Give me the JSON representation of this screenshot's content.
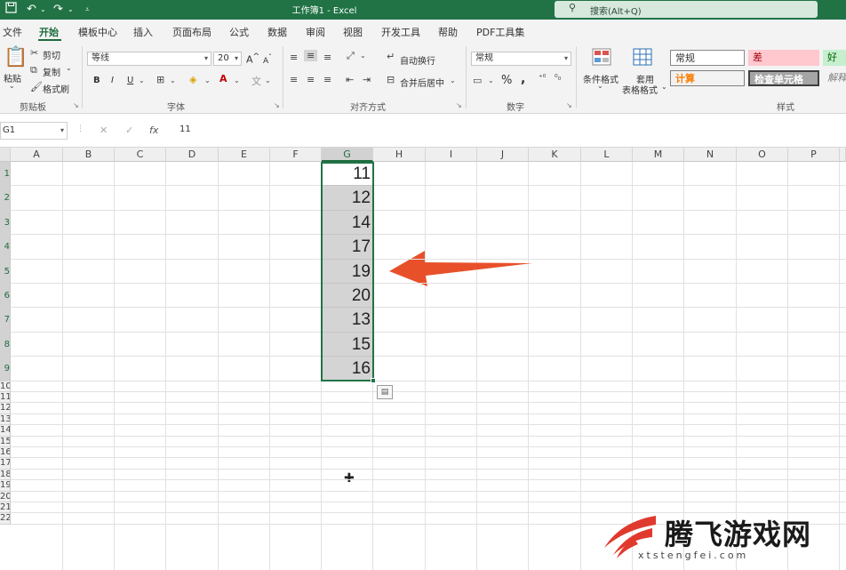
{
  "titlebar": {
    "title": "工作簿1  -  Excel",
    "search_placeholder": "搜索(Alt+Q)",
    "icons": [
      "save-icon",
      "undo-icon",
      "redo-icon",
      "customize-qat-icon",
      "search-icon"
    ]
  },
  "menu": {
    "tabs": [
      "文件",
      "开始",
      "模板中心",
      "插入",
      "页面布局",
      "公式",
      "数据",
      "审阅",
      "视图",
      "开发工具",
      "帮助",
      "PDF工具集"
    ],
    "active_tab": "开始"
  },
  "ribbon": {
    "clipboard": {
      "paste": "粘贴",
      "cut": "剪切",
      "copy": "复制",
      "format_painter": "格式刷",
      "label": "剪贴板"
    },
    "font": {
      "name": "等线",
      "size": "20",
      "bold": "B",
      "italic": "I",
      "underline": "U",
      "increase": "A",
      "decrease": "A",
      "label": "字体"
    },
    "alignment": {
      "wrap_text": "自动换行",
      "merge_center": "合并后居中",
      "label": "对齐方式"
    },
    "number": {
      "format": "常规",
      "percent": "%",
      "comma": ",",
      "label": "数字"
    },
    "styles": {
      "conditional_formatting": "条件格式",
      "format_as_table_1": "套用",
      "format_as_table_2": "表格格式",
      "normal": "常规",
      "bad": "差",
      "good": "好",
      "calculation": "计算",
      "check_cell": "检查单元格",
      "explanatory": "解释",
      "label": "样式"
    }
  },
  "formula_bar": {
    "name_box": "G1",
    "cancel": "✕",
    "enter": "✓",
    "fx": "fx",
    "value": "11"
  },
  "grid": {
    "columns": [
      "A",
      "B",
      "C",
      "D",
      "E",
      "F",
      "G",
      "H",
      "I",
      "J",
      "K",
      "L",
      "M",
      "N",
      "O",
      "P"
    ],
    "selected_column": "G",
    "rows": [
      "1",
      "2",
      "3",
      "4",
      "5",
      "6",
      "7",
      "8",
      "9",
      "10",
      "11",
      "12",
      "13",
      "14",
      "15",
      "16",
      "17",
      "18",
      "19",
      "20",
      "21",
      "22"
    ],
    "g_values": [
      "11",
      "12",
      "14",
      "17",
      "19",
      "20",
      "13",
      "15",
      "16"
    ],
    "selection": "G1:G9"
  },
  "annotation": {
    "arrow_color": "#e8502a"
  },
  "colors": {
    "excel_green": "#217346",
    "selection_fill": "#d4d4d4"
  },
  "watermark": {
    "text": "腾飞游戏网",
    "url": "xtstengfei.com",
    "logo_color": "#e03a2e"
  }
}
